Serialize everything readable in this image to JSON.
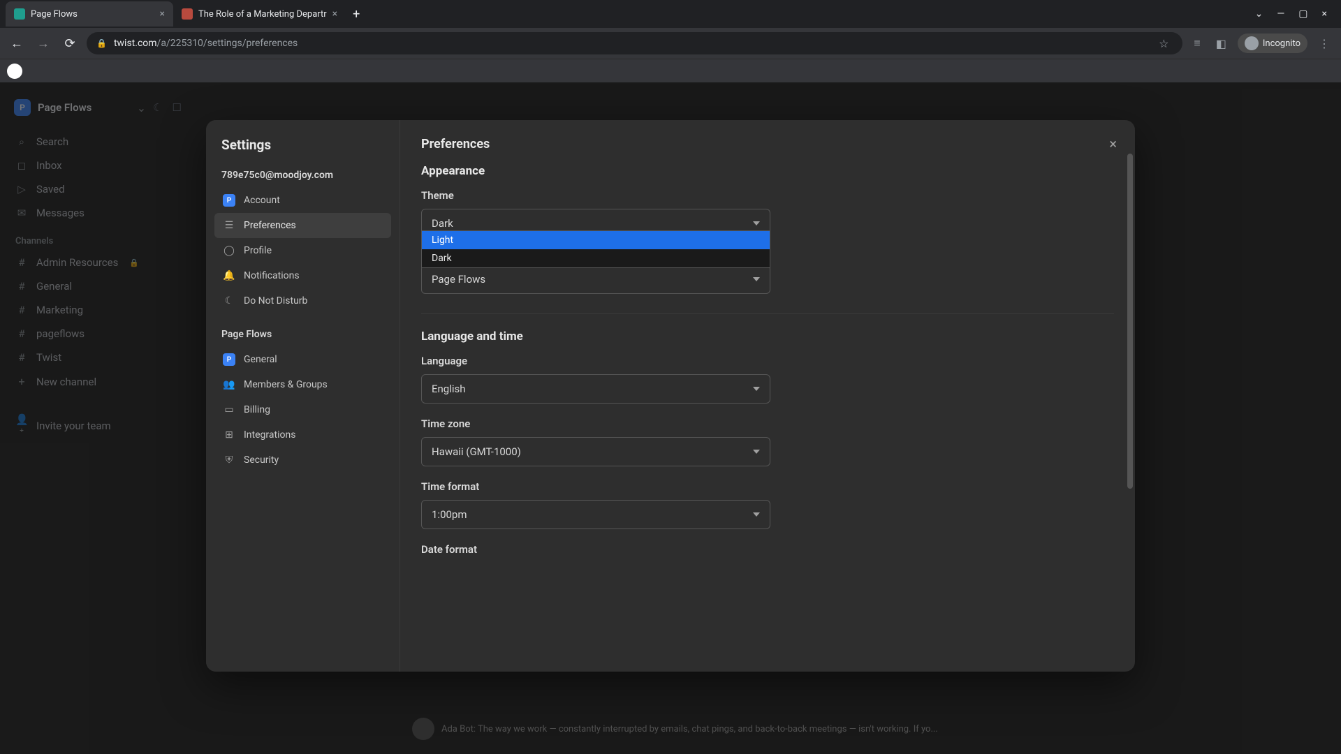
{
  "browser": {
    "tabs": [
      {
        "title": "Page Flows",
        "active": true
      },
      {
        "title": "The Role of a Marketing Departr",
        "active": false
      }
    ],
    "url_domain": "twist.com",
    "url_path": "/a/225310/settings/preferences",
    "incognito_label": "Incognito"
  },
  "app_sidebar": {
    "team_initial": "P",
    "team_name": "Page Flows",
    "nav": [
      "Search",
      "Inbox",
      "Saved",
      "Messages"
    ],
    "channels_label": "Channels",
    "channels": [
      "Admin Resources",
      "General",
      "Marketing",
      "pageflows",
      "Twist"
    ],
    "new_channel": "New channel",
    "invite": "Invite your team"
  },
  "settings": {
    "title": "Settings",
    "email": "789e75c0@moodjoy.com",
    "personal_nav": [
      "Account",
      "Preferences",
      "Profile",
      "Notifications",
      "Do Not Disturb"
    ],
    "team_label": "Page Flows",
    "team_nav": [
      "General",
      "Members & Groups",
      "Billing",
      "Integrations",
      "Security"
    ]
  },
  "preferences": {
    "title": "Preferences",
    "appearance_heading": "Appearance",
    "theme_label": "Theme",
    "theme_value": "Dark",
    "theme_options": [
      "Light",
      "Dark"
    ],
    "default_team_value": "Page Flows",
    "lang_heading": "Language and time",
    "language_label": "Language",
    "language_value": "English",
    "timezone_label": "Time zone",
    "timezone_value": "Hawaii (GMT-1000)",
    "timeformat_label": "Time format",
    "timeformat_value": "1:00pm",
    "dateformat_label": "Date format"
  },
  "background_text": "Ada Bot: The way we work — constantly interrupted by emails, chat pings, and back-to-back meetings — isn't working. If yo..."
}
